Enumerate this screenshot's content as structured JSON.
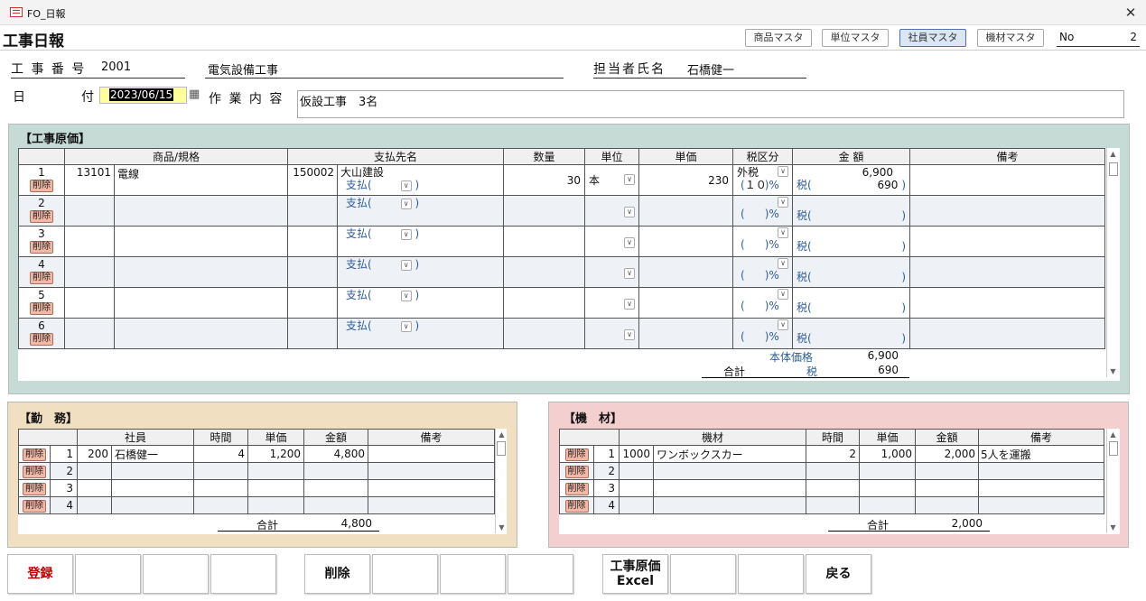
{
  "window": {
    "title": "FO_日報"
  },
  "form": {
    "title": "工事日報"
  },
  "header_buttons": [
    "商品マスタ",
    "単位マスタ",
    "社員マスタ",
    "機材マスタ"
  ],
  "no_label": "No",
  "no_value": "2",
  "header": {
    "koji_label": "工 事 番 号",
    "koji_no": "2001",
    "koji_name": "電気設備工事",
    "tanto_label": "担当者氏名",
    "tanto_name": "石橋健一",
    "date_label_1": "日",
    "date_label_2": "付",
    "date_value": "2023/06/15",
    "sagyo_label": "作 業 内 容",
    "sagyo_value": "仮設工事　3名"
  },
  "cost": {
    "title": "【工事原価】",
    "columns": [
      "商品/規格",
      "支払先名",
      "数量",
      "単位",
      "単価",
      "税区分",
      "金 額",
      "備考"
    ],
    "delete_label": "削除",
    "pay_label": "支払(",
    "paren_close": ")",
    "tax_label": "税(",
    "pct": ")%",
    "paren_open": "(",
    "rows": [
      {
        "no": "1",
        "code": "13101",
        "item": "電線",
        "payee_code": "150002",
        "payee": "大山建設",
        "qty": "30",
        "unit": "本",
        "price": "230",
        "tax_class": "外税",
        "tax_rate": "１０",
        "amount": "6,900",
        "tax": "690"
      },
      {
        "no": "2"
      },
      {
        "no": "3"
      },
      {
        "no": "4"
      },
      {
        "no": "5"
      },
      {
        "no": "6"
      }
    ],
    "body_label": "本体価格",
    "body_value": "6,900",
    "total_label": "合計",
    "total_tax_label": "税",
    "total_tax": "690"
  },
  "kinmu": {
    "title": "【勤　務】",
    "columns": [
      "社員",
      "時間",
      "単価",
      "金額",
      "備考"
    ],
    "rows": [
      {
        "no": "1",
        "code": "200",
        "name": "石橋健一",
        "hours": "4",
        "price": "1,200",
        "amount": "4,800"
      },
      {
        "no": "2"
      },
      {
        "no": "3"
      },
      {
        "no": "4"
      }
    ],
    "total_label": "合計",
    "total_value": "4,800"
  },
  "kizai": {
    "title": "【機　材】",
    "columns": [
      "機材",
      "時間",
      "単価",
      "金額",
      "備考"
    ],
    "rows": [
      {
        "no": "1",
        "code": "1000",
        "name": "ワンボックスカー",
        "hours": "2",
        "price": "1,000",
        "amount": "2,000",
        "note": "5人を運搬"
      },
      {
        "no": "2"
      },
      {
        "no": "3"
      },
      {
        "no": "4"
      }
    ],
    "total_label": "合計",
    "total_value": "2,000"
  },
  "footer": {
    "register": "登録",
    "delete": "削除",
    "excel_1": "工事原価",
    "excel_2": "Excel",
    "back": "戻る"
  },
  "colors": {
    "cost_bg": "#c6dbd6",
    "kinmu_bg": "#f1dfc1",
    "kizai_bg": "#f3cfd0",
    "date_bg": "#ffff99",
    "register": "#c00000"
  }
}
